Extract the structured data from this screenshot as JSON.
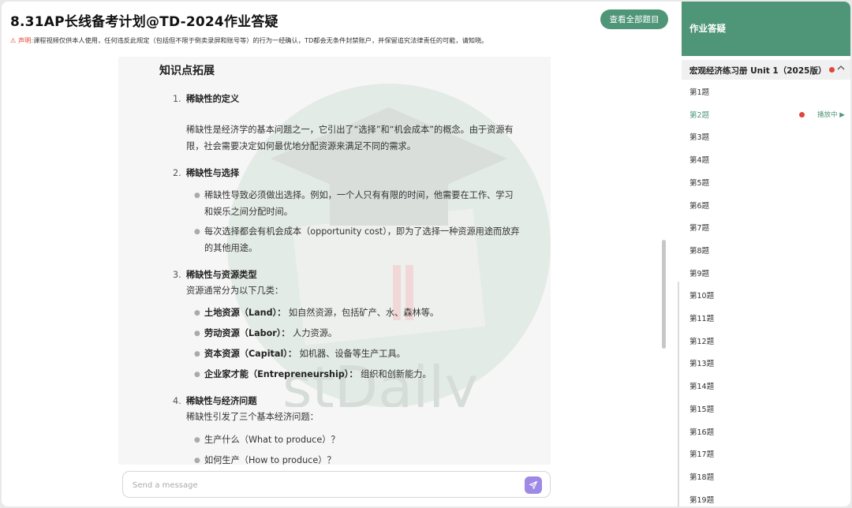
{
  "header": {
    "title": "8.31AP长线备考计划@TD-2024作业答疑",
    "view_all_label": "查看全部题目",
    "disclaimer_label": "声明:",
    "disclaimer_text": "课程视频仅供本人使用，任何违反此规定（包括但不限于倒卖录屏和账号等）的行为一经确认，TD都会无条件封禁账户，并保留追究法律责任的可能，请知晓。"
  },
  "content": {
    "heading": "知识点拓展",
    "sections": [
      {
        "num": "1.",
        "title": "稀缺性的定义",
        "para_lines": [
          "稀缺性是经济学的基本问题之一，它引出了“选择”和“机会成本”的概念。由于资源有",
          "限，社会需要决定如何最优地分配资源来满足不同的需求。"
        ]
      },
      {
        "num": "2.",
        "title": "稀缺性与选择",
        "bullets": [
          [
            "稀缺性导致必须做出选择。例如，一个人只有有限的时间，他需要在工作、学习",
            "和娱乐之间分配时间。"
          ],
          [
            "每次选择都会有机会成本（opportunity cost），即为了选择一种资源用途而放弃",
            "的其他用途。"
          ]
        ]
      },
      {
        "num": "3.",
        "title": "稀缺性与资源类型",
        "intro": "资源通常分为以下几类：",
        "bullets": [
          {
            "term": "土地资源（Land）：",
            "desc": " 如自然资源，包括矿产、水、森林等。"
          },
          {
            "term": "劳动资源（Labor）：",
            "desc": " 人力资源。"
          },
          {
            "term": "资本资源（Capital）：",
            "desc": " 如机器、设备等生产工具。"
          },
          {
            "term": "企业家才能（Entrepreneurship）：",
            "desc": " 组织和创新能力。"
          }
        ]
      },
      {
        "num": "4.",
        "title": "稀缺性与经济问题",
        "intro": "稀缺性引发了三个基本经济问题：",
        "bullets": [
          "生产什么（What to produce）？",
          "如何生产（How to produce）？"
        ]
      }
    ],
    "watermark_text": "stDaily"
  },
  "composer": {
    "placeholder": "Send a message"
  },
  "sidebar": {
    "title": "作业答疑",
    "section_label": "宏观经济练习册 Unit 1（2025版）",
    "active_status": "播放中 ▶",
    "items": [
      "第1题",
      "第2题",
      "第3题",
      "第4题",
      "第5题",
      "第6题",
      "第7题",
      "第8题",
      "第9题",
      "第10题",
      "第11题",
      "第12题",
      "第13题",
      "第14题",
      "第15题",
      "第16题",
      "第17题",
      "第18题",
      "第19题"
    ],
    "active_index": 1
  },
  "colors": {
    "accent": "#4f9678",
    "alert": "#e0463a",
    "send": "#9f89e6"
  }
}
